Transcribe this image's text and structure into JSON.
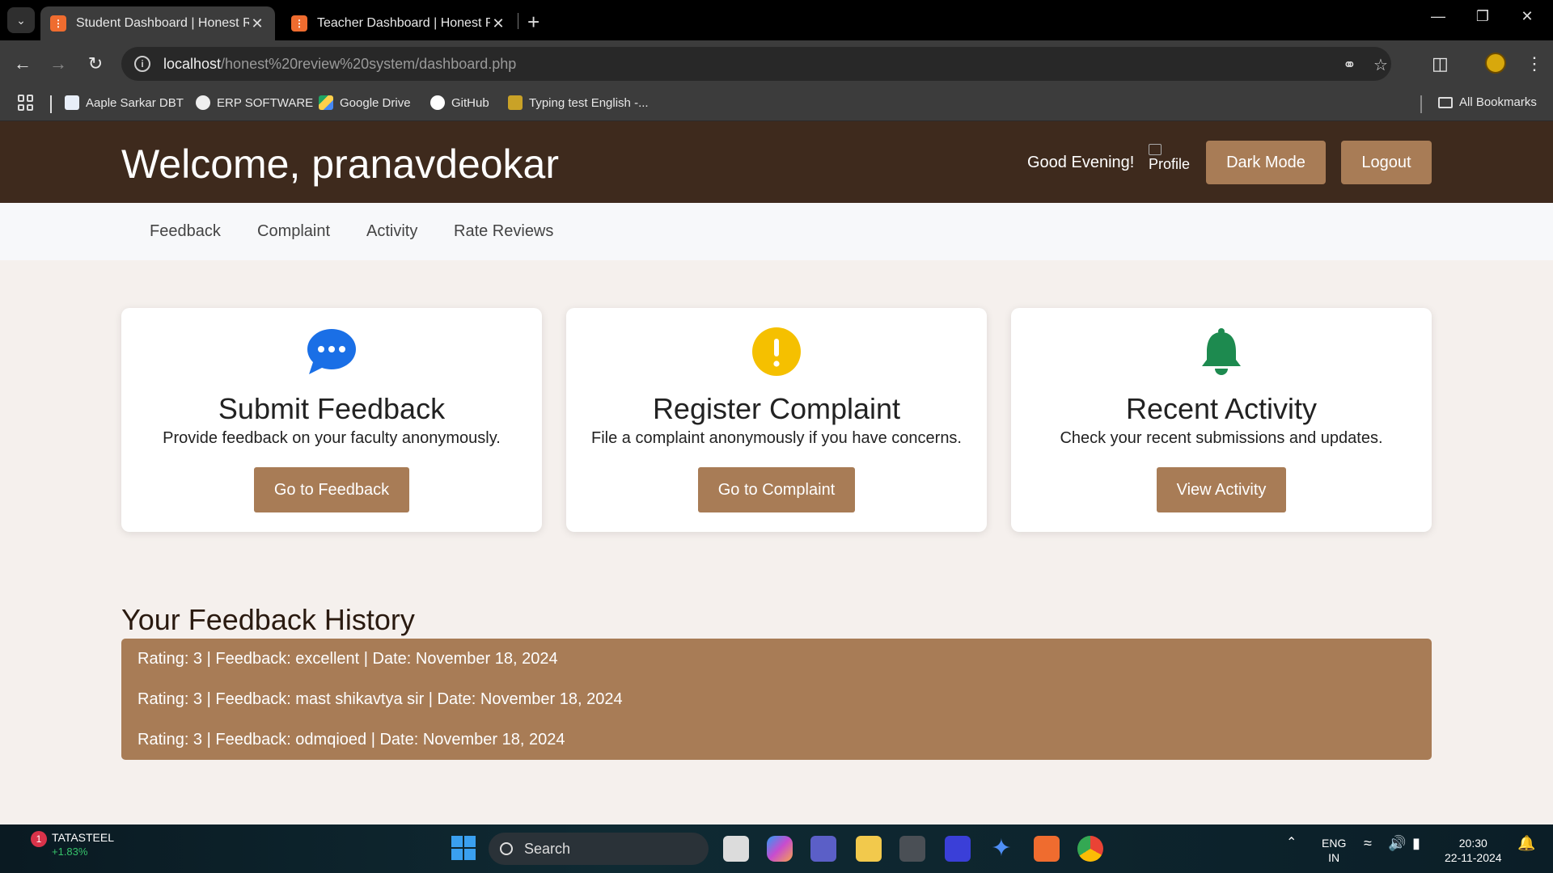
{
  "browser": {
    "tabs": [
      {
        "title": "Student Dashboard | Honest Re",
        "active": true
      },
      {
        "title": "Teacher Dashboard | Honest Re",
        "active": false
      }
    ],
    "url_host": "localhost",
    "url_path": "/honest%20review%20system/dashboard.php",
    "bookmarks": [
      "Aaple Sarkar DBT",
      "ERP SOFTWARE",
      "Google Drive",
      "GitHub",
      "Typing test English -..."
    ],
    "all_bookmarks": "All Bookmarks"
  },
  "header": {
    "welcome": "Welcome, pranavdeokar",
    "greeting": "Good Evening!",
    "profile_alt": "Profile",
    "dark_mode_label": "Dark Mode",
    "logout_label": "Logout"
  },
  "nav": [
    "Feedback",
    "Complaint",
    "Activity",
    "Rate Reviews"
  ],
  "cards": [
    {
      "title": "Submit Feedback",
      "desc": "Provide feedback on your faculty anonymously.",
      "button": "Go to Feedback",
      "icon": "chat-bubble-icon",
      "color": "#1a6fe6"
    },
    {
      "title": "Register Complaint",
      "desc": "File a complaint anonymously if you have concerns.",
      "button": "Go to Complaint",
      "icon": "exclamation-icon",
      "color": "#f5c000"
    },
    {
      "title": "Recent Activity",
      "desc": "Check your recent submissions and updates.",
      "button": "View Activity",
      "icon": "bell-icon",
      "color": "#1d8a4f"
    }
  ],
  "history": {
    "title": "Your Feedback History",
    "items": [
      "Rating: 3 | Feedback: excellent | Date: November 18, 2024",
      "Rating: 3 | Feedback: mast shikavtya sir | Date: November 18, 2024",
      "Rating: 3 | Feedback: odmqioed | Date: November 18, 2024"
    ]
  },
  "taskbar": {
    "stock_name": "TATASTEEL",
    "stock_change": "+1.83%",
    "stock_badge": "1",
    "search": "Search",
    "lang": "ENG",
    "region": "IN",
    "time": "20:30",
    "date": "22-11-2024"
  },
  "colors": {
    "header_bg": "#3e2a1d",
    "accent": "#a87c56",
    "page_bg": "#f5f0ed"
  }
}
